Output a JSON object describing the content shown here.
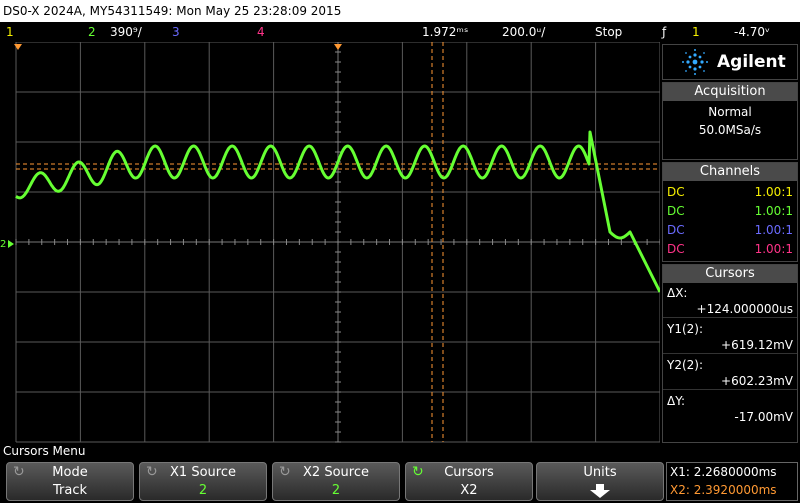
{
  "title": "DS0-X 2024A, MY54311549: Mon May 25 23:28:09 2015",
  "status": {
    "ch1_label": "1",
    "ch2_label": "2",
    "ch2_scale": "390⁹/",
    "ch3_label": "3",
    "ch4_label": "4",
    "delay": "1.972ᵐˢ",
    "timebase": "200.0ᵘ/",
    "run_state": "Stop",
    "trigger_icon": "ƒ",
    "trigger_source": "1",
    "trigger_level": "-4.70ᵛ"
  },
  "colors": {
    "ch1": "#f6f000",
    "ch2": "#66ff33",
    "ch3": "#6b6bff",
    "ch4": "#ff3388",
    "cursor": "#ff9933",
    "grid": "#5a5a5a"
  },
  "logo": {
    "text": "Agilent",
    "icon": "agilent-spark-icon"
  },
  "acquisition": {
    "header": "Acquisition",
    "mode": "Normal",
    "rate": "50.0MSa/s"
  },
  "channels": {
    "header": "Channels",
    "rows": [
      {
        "coupling": "DC",
        "probe": "1.00:1"
      },
      {
        "coupling": "DC",
        "probe": "1.00:1"
      },
      {
        "coupling": "DC",
        "probe": "1.00:1"
      },
      {
        "coupling": "DC",
        "probe": "1.00:1"
      }
    ]
  },
  "cursors": {
    "header": "Cursors",
    "dx_label": "ΔX:",
    "dx_value": "+124.000000us",
    "y1_label": "Y1(2):",
    "y1_value": "+619.12mV",
    "y2_label": "Y2(2):",
    "y2_value": "+602.23mV",
    "dy_label": "ΔY:",
    "dy_value": "-17.00mV"
  },
  "menu": {
    "title": "Cursors Menu",
    "softkeys": [
      {
        "top": "Mode",
        "bottom": "Track"
      },
      {
        "top": "X1 Source",
        "bottom": "2"
      },
      {
        "top": "X2 Source",
        "bottom": "2"
      },
      {
        "top": "Cursors",
        "bottom": "X2"
      },
      {
        "top": "Units",
        "bottom": ""
      }
    ],
    "x1_readout": "X1: 2.2680000ms",
    "x2_readout": "X2: 2.3920000ms"
  }
}
